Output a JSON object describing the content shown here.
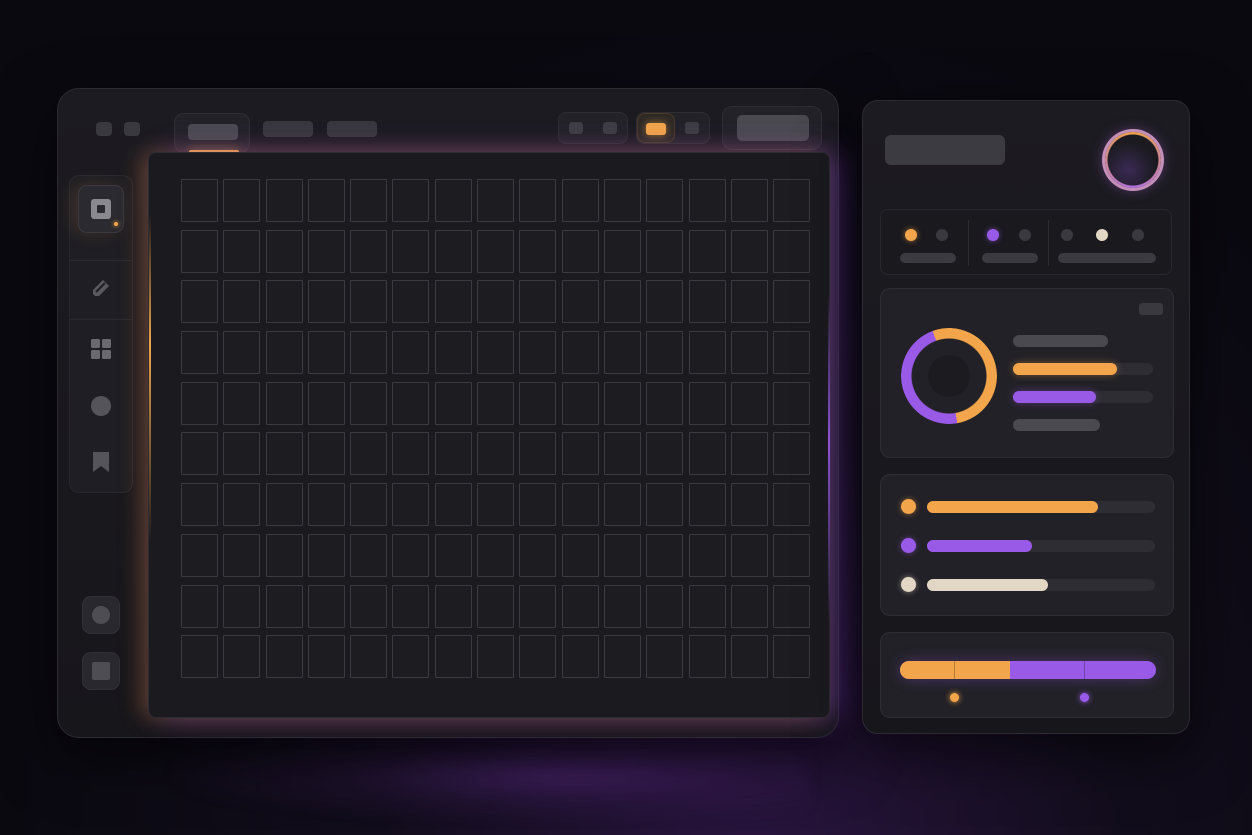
{
  "colors": {
    "accent_orange": "#f2a54a",
    "accent_purple": "#9a5ae8",
    "accent_cream": "#e2d6c4",
    "muted": "#3a3940",
    "panel_bg": "#1c1b21"
  },
  "toolbar": {
    "window_controls": [
      "window-control",
      "window-control"
    ],
    "tabs": [
      {
        "label": "",
        "active": true
      },
      {
        "label": "",
        "active": false
      },
      {
        "label": "",
        "active": false
      }
    ],
    "tool_groups": [
      {
        "name": "view-tools",
        "items": [
          "tool",
          "tool"
        ]
      },
      {
        "name": "mode-tools",
        "items": [
          "tool-active",
          "tool"
        ],
        "active_index": 0
      }
    ],
    "primary_action_label": ""
  },
  "sidebar": {
    "items": [
      {
        "icon": "select-square-icon",
        "selected": true
      },
      {
        "icon": "pencil-icon",
        "selected": false
      },
      {
        "icon": "grid-icon",
        "selected": false
      },
      {
        "icon": "circle-icon",
        "selected": false
      },
      {
        "icon": "bookmark-icon",
        "selected": false
      }
    ],
    "bottom_items": [
      {
        "icon": "circle-icon"
      },
      {
        "icon": "square-icon"
      }
    ]
  },
  "canvas": {
    "grid_columns": 15,
    "grid_rows": 10
  },
  "inspector": {
    "title": "",
    "status_groups": [
      {
        "dots": [
          "#f2a54a",
          "#3a3940"
        ]
      },
      {
        "dots": [
          "#9a5ae8",
          "#3a3940"
        ]
      },
      {
        "dots": [
          "#3a3940",
          "#e2d6c4",
          "#3a3940"
        ]
      }
    ],
    "donut_card": {
      "segments": [
        {
          "color": "#f2a54a",
          "fraction": 0.53
        },
        {
          "color": "#9a5ae8",
          "fraction": 0.47
        }
      ],
      "bars": [
        {
          "color": "#4a4950",
          "fraction": 0.68
        },
        {
          "color": "#f2a54a",
          "fraction": 0.74
        },
        {
          "color": "#9a5ae8",
          "fraction": 0.59
        },
        {
          "color": "#4a4950",
          "fraction": 0.62
        }
      ]
    },
    "legend_card": {
      "items": [
        {
          "color": "#f2a54a",
          "fraction": 0.75
        },
        {
          "color": "#9a5ae8",
          "fraction": 0.46
        },
        {
          "color": "#e2d6c4",
          "fraction": 0.53
        }
      ]
    },
    "range_card": {
      "split_fraction": 0.43,
      "markers": [
        {
          "color": "#f2a54a",
          "position_fraction": 0.21
        },
        {
          "color": "#9a5ae8",
          "position_fraction": 0.72
        }
      ]
    }
  }
}
